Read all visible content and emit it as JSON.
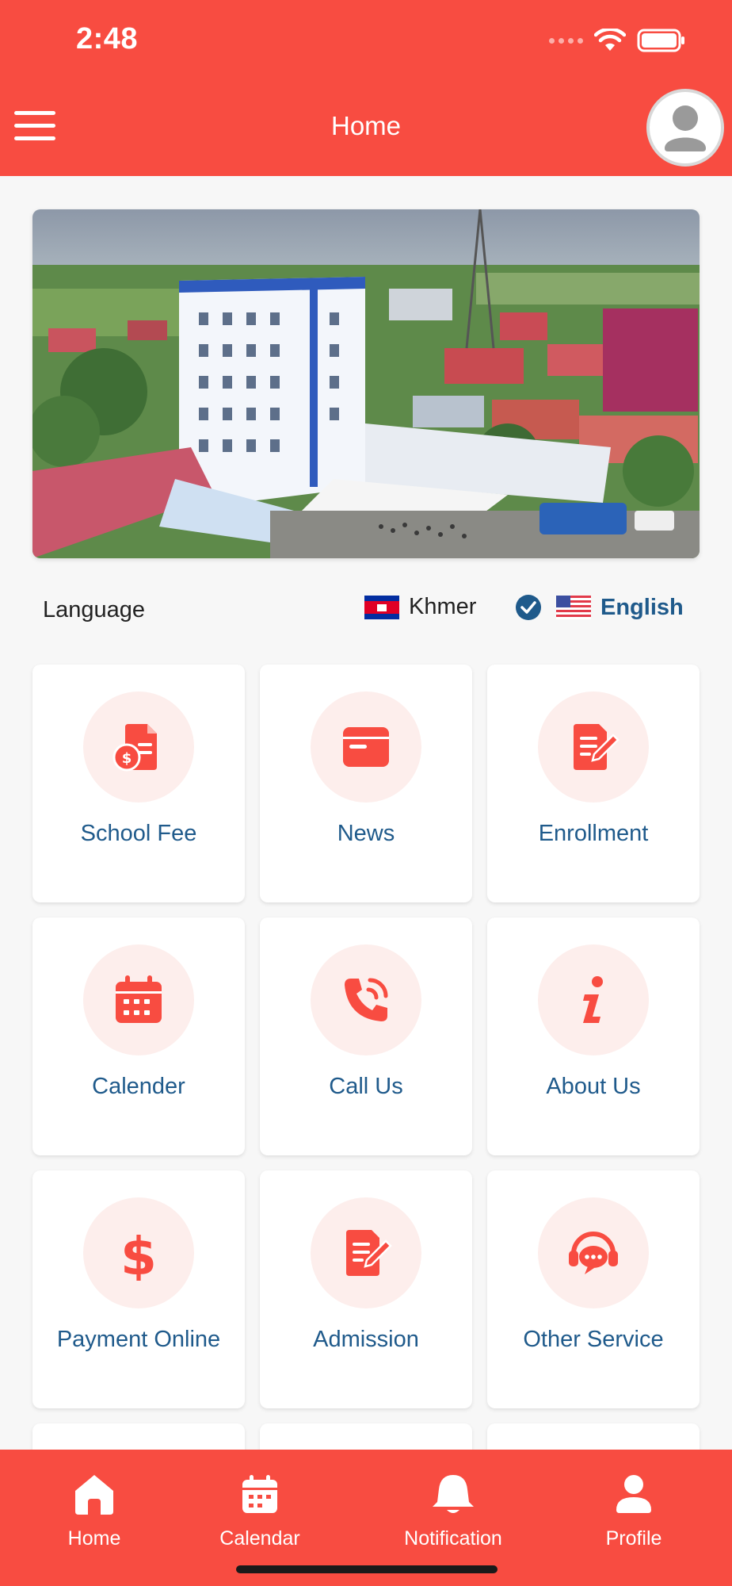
{
  "status_bar": {
    "time": "2:48"
  },
  "header": {
    "title": "Home",
    "menu_icon": "hamburger-menu-icon",
    "avatar_icon": "user-avatar-icon"
  },
  "language": {
    "label": "Language",
    "options": [
      {
        "name": "Khmer",
        "flag": "cambodia-flag",
        "selected": false
      },
      {
        "name": "English",
        "flag": "usa-flag",
        "selected": true
      }
    ]
  },
  "menu": [
    {
      "label": "School Fee",
      "icon": "invoice-dollar-icon"
    },
    {
      "label": "News",
      "icon": "browser-window-icon"
    },
    {
      "label": "Enrollment",
      "icon": "document-edit-icon"
    },
    {
      "label": "Calender",
      "icon": "calendar-icon"
    },
    {
      "label": "Call Us",
      "icon": "phone-call-icon"
    },
    {
      "label": "About Us",
      "icon": "info-icon"
    },
    {
      "label": "Payment Online",
      "icon": "dollar-sign-icon"
    },
    {
      "label": "Admission",
      "icon": "document-edit-icon"
    },
    {
      "label": "Other Service",
      "icon": "headset-chat-icon"
    }
  ],
  "bottom_nav": [
    {
      "label": "Home",
      "icon": "home-icon"
    },
    {
      "label": "Calendar",
      "icon": "calendar-icon"
    },
    {
      "label": "Notification",
      "icon": "bell-icon"
    },
    {
      "label": "Profile",
      "icon": "person-icon"
    }
  ],
  "colors": {
    "primary": "#f84c41",
    "text_accent": "#1f5a8b",
    "icon_bg": "#fdeeec"
  }
}
